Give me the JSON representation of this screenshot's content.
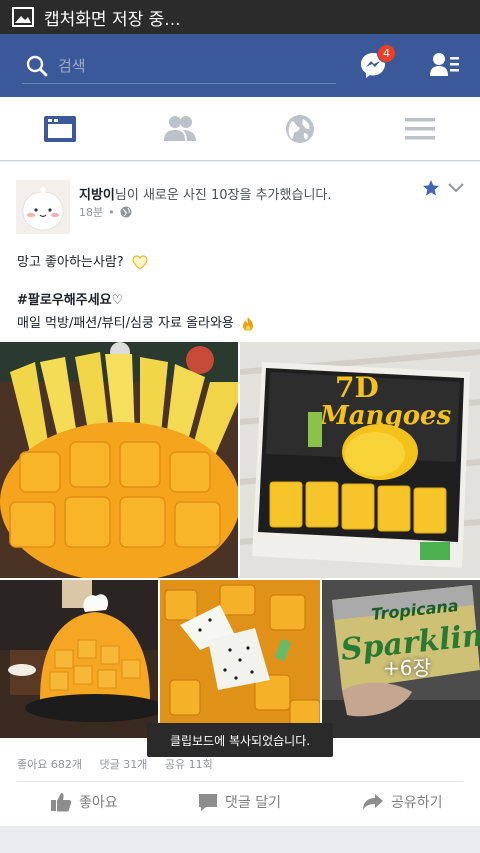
{
  "status_bar": {
    "text": "캡처화면 저장 중...",
    "icon": "image-icon"
  },
  "header": {
    "search_placeholder": "검색",
    "messenger_badge": "4",
    "brand_color": "#3b5998"
  },
  "tabs": [
    {
      "name": "news-feed",
      "icon": "news-feed-icon",
      "active": true
    },
    {
      "name": "friends",
      "icon": "friends-icon",
      "active": false
    },
    {
      "name": "notifications",
      "icon": "globe-icon",
      "active": false
    },
    {
      "name": "menu",
      "icon": "menu-icon",
      "active": false
    }
  ],
  "post": {
    "author": "지방이",
    "action": "님이 새로운 사진 10장을 추가했습니다.",
    "time": "18분",
    "privacy_icon": "globe-icon",
    "line1": "망고 좋아하는사람?",
    "line2": "#팔로우해주세요♡",
    "line3": "매일 먹방/패션/뷰티/심쿵 자료 올라와용",
    "more_photos": "+6장",
    "likes": "좋아요 682개",
    "comments": "댓글 31개",
    "shares": "공유 11회"
  },
  "actions": {
    "like": "좋아요",
    "comment": "댓글 달기",
    "share": "공유하기"
  },
  "toast": "클립보드에 복사되었습니다."
}
